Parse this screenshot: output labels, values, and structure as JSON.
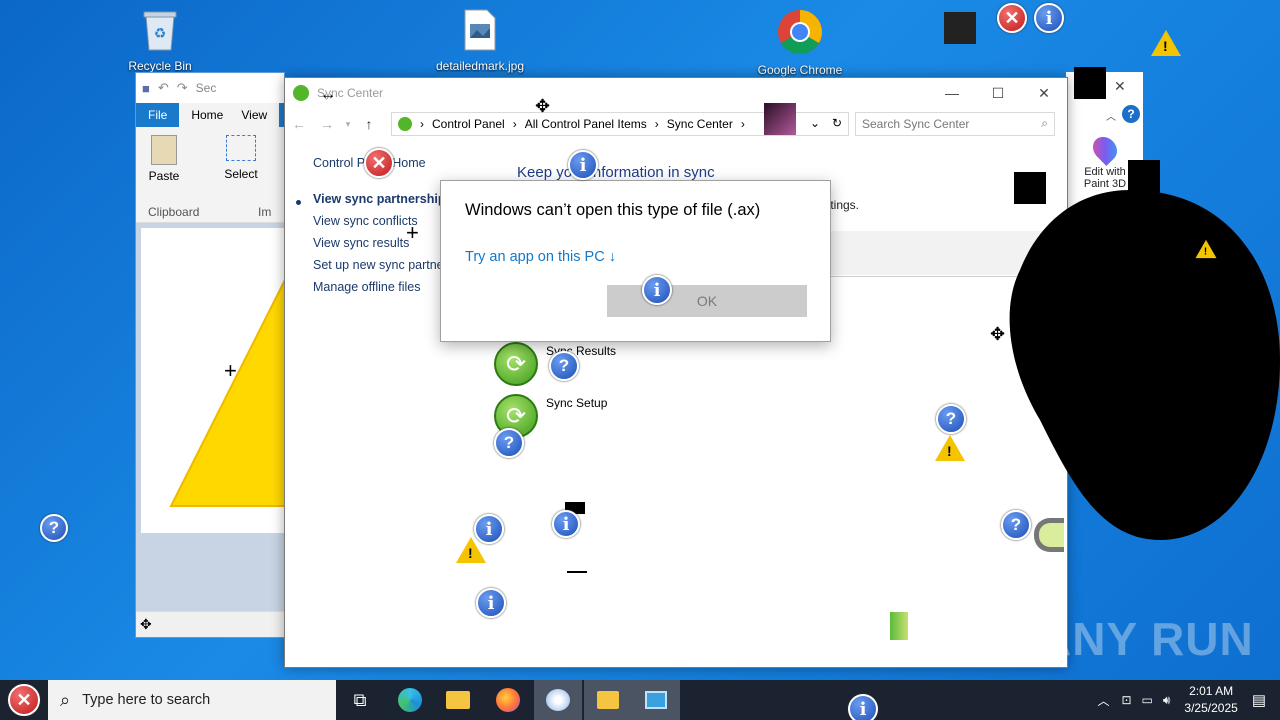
{
  "desktop": {
    "icons": [
      {
        "name": "recycle-bin",
        "label": "Recycle Bin"
      },
      {
        "name": "detailedmark-file",
        "label": "detailedmark.jpg"
      },
      {
        "name": "google-chrome",
        "label": "Google Chrome"
      }
    ],
    "watermark": "ANY RUN"
  },
  "paint": {
    "tab_file": "File",
    "tab_home": "Home",
    "tab_view": "View",
    "paste_label": "Paste",
    "select_label": "Select",
    "clipboard_label": "Clipboard",
    "title_snippet": "Sec",
    "images_snippet": "Im"
  },
  "photos": {
    "edit_label_1": "Edit with",
    "edit_label_2": "Paint 3D"
  },
  "sync_center": {
    "title": "Sync Center",
    "breadcrumb": [
      "Control Panel",
      "All Control Panel Items",
      "Sync Center"
    ],
    "search_placeholder": "Search Sync Center",
    "left_nav": {
      "home": "Control Panel Home",
      "partnerships": "View sync partnerships",
      "conflicts": "View sync conflicts",
      "results": "View sync results",
      "setup": "Set up new sync partnership",
      "offline": "Manage offline files"
    },
    "heading": "Keep your information in sync",
    "settings_snippet": "ttings.",
    "items": [
      {
        "label": "Sync Results"
      },
      {
        "label": "Sync Setup"
      }
    ]
  },
  "dialog": {
    "title": "Windows can’t open this type of file (.ax)",
    "link": "Try an app on this PC ↓",
    "ok": "OK"
  },
  "taskbar": {
    "search_placeholder": "Type here to search",
    "time": "2:01 AM",
    "date": "3/25/2025"
  },
  "colors": {
    "accent": "#1479c9",
    "taskbar": "#1b2331",
    "desktop": "#1477d2"
  }
}
